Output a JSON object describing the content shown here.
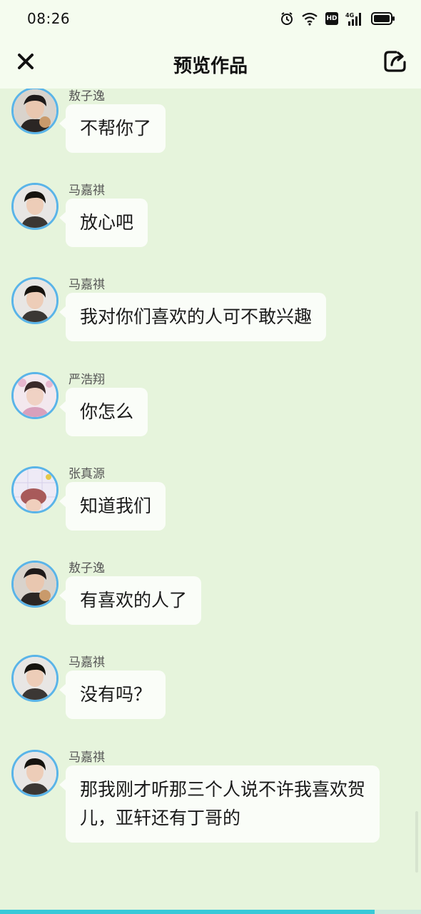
{
  "status_bar": {
    "time": "08:26",
    "icons": [
      "alarm-icon",
      "wifi-icon",
      "hd-icon",
      "signal-4g-icon",
      "battery-icon"
    ],
    "hd_label": "HD"
  },
  "header": {
    "title": "预览作品",
    "close_icon": "close-icon",
    "share_icon": "share-icon"
  },
  "messages": [
    {
      "sender": "敖子逸",
      "text": "不帮你了",
      "avatar": "avatar-aoziyi"
    },
    {
      "sender": "马嘉祺",
      "text": "放心吧",
      "avatar": "avatar-majiaqi"
    },
    {
      "sender": "马嘉祺",
      "text": "我对你们喜欢的人可不敢兴趣",
      "avatar": "avatar-majiaqi"
    },
    {
      "sender": "严浩翔",
      "text": "你怎么",
      "avatar": "avatar-yanhaoxiang"
    },
    {
      "sender": "张真源",
      "text": "知道我们",
      "avatar": "avatar-zhangzhenyuan"
    },
    {
      "sender": "敖子逸",
      "text": "有喜欢的人了",
      "avatar": "avatar-aoziyi"
    },
    {
      "sender": "马嘉祺",
      "text": "没有吗？",
      "avatar": "avatar-majiaqi"
    },
    {
      "sender": "马嘉祺",
      "text": "那我刚才听那三个人说不许我喜欢贺儿，亚轩还有丁哥的",
      "avatar": "avatar-majiaqi"
    }
  ],
  "progress": {
    "fraction": 0.89
  },
  "colors": {
    "background": "#e6f4dc",
    "header": "#f5fcef",
    "avatar_border": "#5ab4e8",
    "bubble": "#fafdf8",
    "progress": "#38c9d8"
  }
}
